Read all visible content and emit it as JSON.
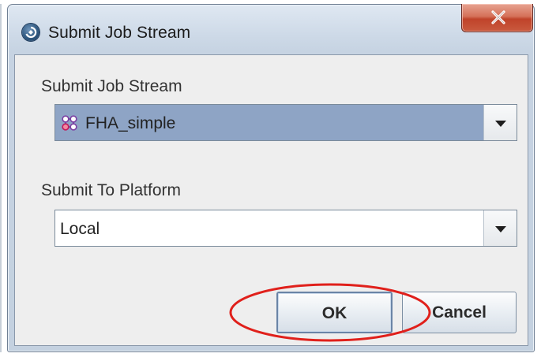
{
  "window": {
    "title": "Submit Job Stream",
    "close_label": "X"
  },
  "job_stream": {
    "label": "Submit Job Stream",
    "selected": "FHA_simple",
    "icon": "job-stream-node-icon"
  },
  "platform": {
    "label": "Submit To Platform",
    "selected": "Local"
  },
  "buttons": {
    "ok": "OK",
    "cancel": "Cancel"
  },
  "colors": {
    "selection_highlight": "#8ea4c5",
    "annotation_circle": "#e0201b",
    "close_button": "#c95a3f"
  }
}
